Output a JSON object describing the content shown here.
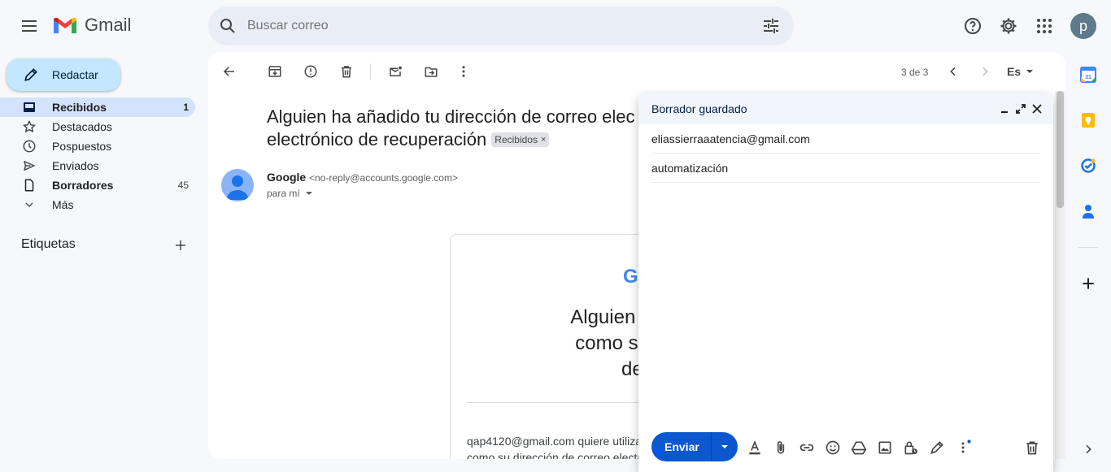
{
  "app": {
    "name": "Gmail"
  },
  "search": {
    "placeholder": "Buscar correo"
  },
  "compose_button": {
    "label": "Redactar"
  },
  "nav": {
    "items": [
      {
        "label": "Recibidos",
        "count": "1"
      },
      {
        "label": "Destacados",
        "count": ""
      },
      {
        "label": "Pospuestos",
        "count": ""
      },
      {
        "label": "Enviados",
        "count": ""
      },
      {
        "label": "Borradores",
        "count": "45"
      },
      {
        "label": "Más",
        "count": ""
      }
    ],
    "labels_title": "Etiquetas"
  },
  "account": {
    "avatar_letter": "p"
  },
  "toolbar": {
    "pager": "3 de 3",
    "language": "Es"
  },
  "email": {
    "subject_line1": "Alguien ha añadido tu dirección de correo elec",
    "subject_line2": "electrónico de recuperación",
    "tag": "Recibidos",
    "sender_name": "Google",
    "sender_email": "<no-reply@accounts.google.com>",
    "recipient": "para mí",
    "card": {
      "logo": "G",
      "title_lines": [
        "Alguien ha añadido",
        "como su dirección",
        "de recu"
      ],
      "body_line1": "qap4120@gmail.com quiere utiliza",
      "body_line2": "como su dirección de correo electr"
    }
  },
  "compose_window": {
    "title": "Borrador guardado",
    "to": "eliassierraaatencia@gmail.com",
    "subject": "automatización",
    "send_label": "Enviar"
  },
  "colors": {
    "accent": "#0b57d0",
    "compose_bg": "#c2e7ff",
    "active_nav": "#d3e3fd",
    "background": "#f6f8fc"
  },
  "icons": [
    "menu-icon",
    "search-icon",
    "filter-icon",
    "help-icon",
    "settings-icon",
    "apps-icon",
    "pencil-icon",
    "inbox-icon",
    "star-icon",
    "clock-icon",
    "send-icon",
    "file-icon",
    "chevron-down-icon",
    "plus-icon",
    "back-arrow-icon",
    "archive-icon",
    "report-spam-icon",
    "trash-icon",
    "mark-unread-icon",
    "move-to-icon",
    "more-vert-icon",
    "chevron-left-icon",
    "chevron-right-icon",
    "minimize-icon",
    "expand-icon",
    "close-icon",
    "text-format-icon",
    "attach-icon",
    "link-icon",
    "emoji-icon",
    "drive-icon",
    "image-icon",
    "lock-clock-icon",
    "signature-icon",
    "calendar-icon",
    "keep-icon",
    "tasks-icon",
    "contacts-icon"
  ]
}
